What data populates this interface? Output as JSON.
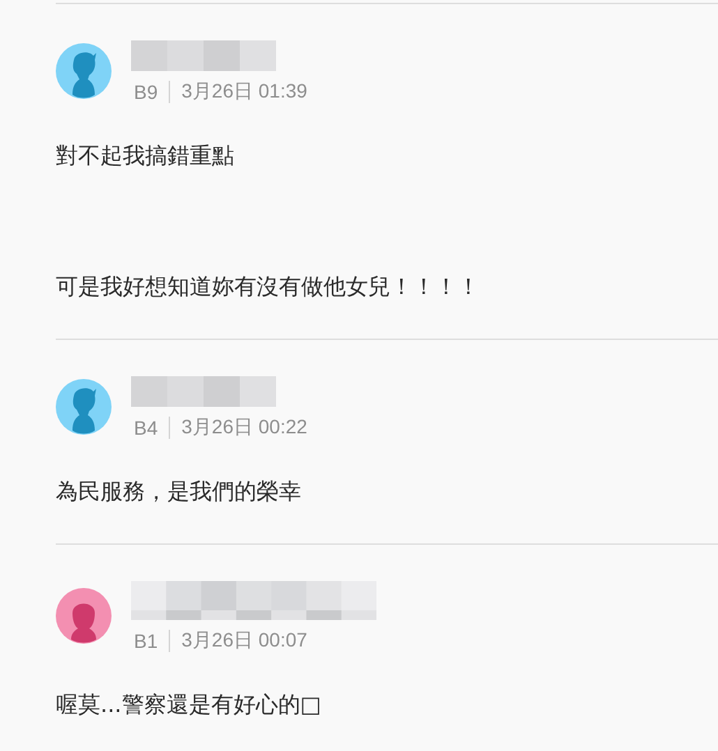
{
  "comments": [
    {
      "avatar": {
        "kind": "male"
      },
      "floor": "B9",
      "time": "3月26日 01:39",
      "paragraphs": [
        "對不起我搞錯重點",
        "可是我好想知道妳有沒有做他女兒！！！！"
      ]
    },
    {
      "avatar": {
        "kind": "male"
      },
      "floor": "B4",
      "time": "3月26日 00:22",
      "paragraphs": [
        "為民服務，是我們的榮幸"
      ]
    },
    {
      "avatar": {
        "kind": "female"
      },
      "floor": "B1",
      "time": "3月26日 00:07",
      "paragraphs": [
        "喔莫...警察還是有好心的□"
      ]
    }
  ]
}
